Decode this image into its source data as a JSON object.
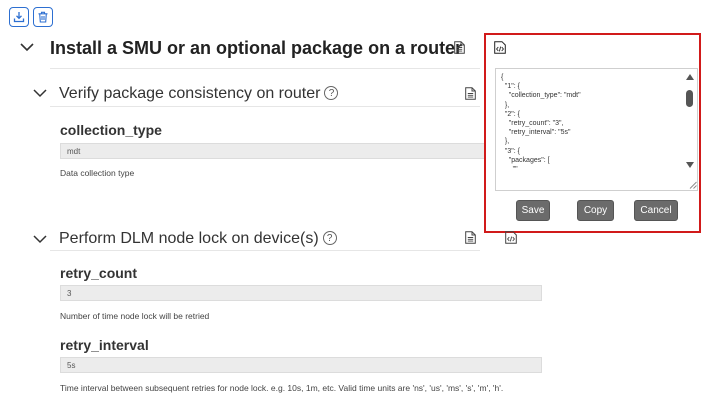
{
  "toolbar": {
    "download_icon": "download-icon",
    "delete_icon": "trash-icon"
  },
  "main_section": {
    "title": "Install a SMU or an optional package on a router"
  },
  "sections": [
    {
      "title": "Verify package consistency on router",
      "fields": [
        {
          "label": "collection_type",
          "value": "mdt",
          "description": "Data collection type"
        }
      ]
    },
    {
      "title": "Perform DLM node lock on device(s)",
      "fields": [
        {
          "label": "retry_count",
          "value": "3",
          "description": "Number of time node lock will be retried"
        },
        {
          "label": "retry_interval",
          "value": "5s",
          "description": "Time interval between subsequent retries for node lock. e.g. 10s, 1m, etc. Valid time units are 'ns', 'us', 'ms', 's', 'm', 'h'."
        }
      ]
    }
  ],
  "popup": {
    "json_text": "{\n  \"1\": {\n    \"collection_type\": \"mdt\"\n  },\n  \"2\": {\n    \"retry_count\": \"3\",\n    \"retry_interval\": \"5s\"\n  },\n  \"3\": {\n    \"packages\": [\n      \"\"",
    "save_label": "Save",
    "copy_label": "Copy",
    "cancel_label": "Cancel"
  },
  "colors": {
    "accent": "#2d6fd1",
    "popup_border": "#d11a1a",
    "button_bg": "#6b6b6b"
  }
}
